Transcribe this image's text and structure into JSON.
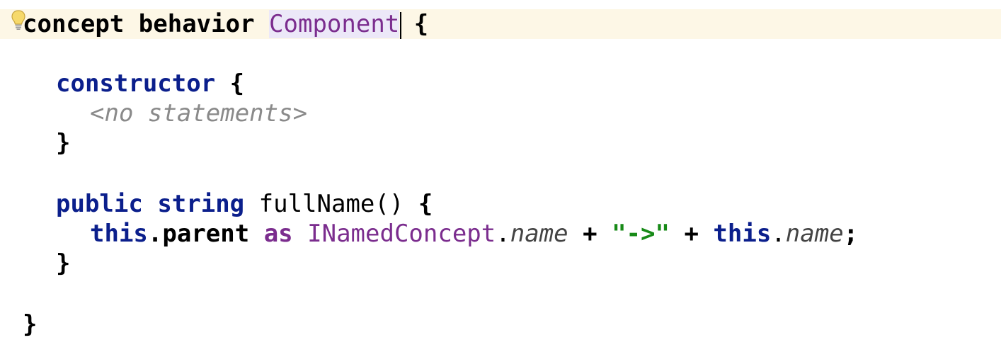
{
  "editor": {
    "line1": {
      "kw_concept": "concept",
      "kw_behavior": "behavior",
      "concept_name": "Component",
      "brace": "{"
    },
    "line2": {
      "kw_constructor": "constructor",
      "brace": "{"
    },
    "line3": {
      "placeholder": "<no statements>"
    },
    "line4": {
      "brace": "}"
    },
    "line5": {
      "kw_public": "public",
      "kw_string": "string",
      "method_name": "fullName",
      "parens": "()",
      "brace": "{"
    },
    "line6": {
      "kw_this1": "this",
      "dot1": ".",
      "member_parent": "parent",
      "kw_as": "as",
      "type_name": "INamedConcept",
      "dot2": ".",
      "member_name1": "name",
      "op_plus1": "+",
      "string_literal": "\"->\"",
      "op_plus2": "+",
      "kw_this2": "this",
      "dot3": ".",
      "member_name2": "name",
      "semicolon": ";"
    },
    "line7": {
      "brace": "}"
    },
    "line8": {
      "brace": "}"
    }
  },
  "icons": {
    "intention": "lightbulb-icon"
  },
  "colors": {
    "keyword_black": "#000000",
    "keyword_blue": "#0b1f8c",
    "keyword_purple": "#7b2d8e",
    "string_green": "#178a17",
    "hint_gray": "#8a8a8a",
    "current_line_bg": "#fdf7e6",
    "selection_bg": "#ece8f8"
  }
}
